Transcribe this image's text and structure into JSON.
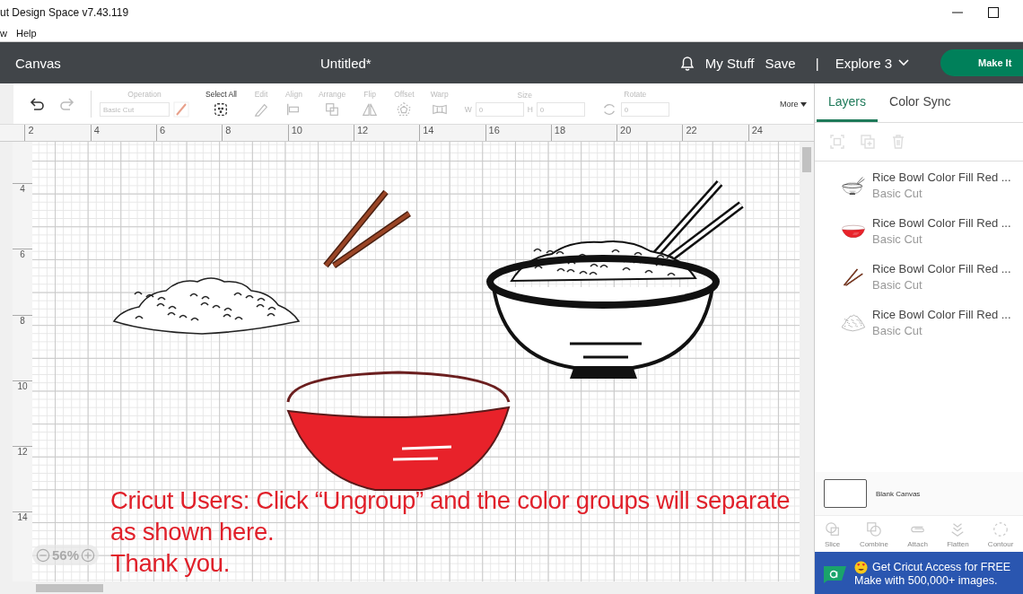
{
  "window": {
    "title": "ut Design Space  v7.43.119"
  },
  "menu": [
    "w",
    "Help"
  ],
  "header": {
    "section": "Canvas",
    "document": "Untitled*",
    "links": [
      "My Stuff",
      "Save"
    ],
    "separator": "|",
    "machine": "Explore 3",
    "make_button": "Make It"
  },
  "toolbar": {
    "history": [
      {
        "disabled": false
      },
      {
        "disabled": true
      }
    ],
    "items": [
      {
        "kind": "operation",
        "label": "Operation",
        "value": "Basic Cut",
        "disabled": true
      },
      {
        "kind": "tool",
        "label": "Select All",
        "disabled": false
      },
      {
        "kind": "tool",
        "label": "Edit",
        "disabled": true
      },
      {
        "kind": "tool",
        "label": "Align",
        "disabled": true
      },
      {
        "kind": "tool",
        "label": "Arrange",
        "disabled": true
      },
      {
        "kind": "tool",
        "label": "Flip",
        "disabled": true
      },
      {
        "kind": "tool",
        "label": "Offset",
        "disabled": true
      },
      {
        "kind": "tool",
        "label": "Warp",
        "disabled": true
      },
      {
        "kind": "size",
        "label": "Size",
        "fields": [
          {
            "label": "W",
            "value": "0"
          },
          {
            "label": "H",
            "value": "0"
          }
        ],
        "disabled": true
      },
      {
        "kind": "rotate",
        "label": "Rotate",
        "value": "0",
        "disabled": true
      },
      {
        "kind": "more",
        "label": "More"
      }
    ]
  },
  "top_ruler": [
    "2",
    "4",
    "6",
    "8",
    "10",
    "12",
    "14",
    "16",
    "18",
    "20",
    "22",
    "24"
  ],
  "left_ruler": [
    "4",
    "6",
    "8",
    "10",
    "12",
    "14"
  ],
  "canvas": {
    "annotation": [
      "Cricut Users: Click “Ungroup” and the color groups will separate",
      "as shown here.",
      "Thank you."
    ],
    "zoom": "56%"
  },
  "panel": {
    "tabs": [
      {
        "label": "Layers",
        "selected": true
      },
      {
        "label": "Color Sync",
        "selected": false
      }
    ],
    "layers": [
      {
        "kind": "bowl",
        "name": "Rice Bowl Color Fill Red ...",
        "operation": "Basic Cut"
      },
      {
        "kind": "red-bowl",
        "name": "Rice Bowl Color Fill Red ...",
        "operation": "Basic Cut"
      },
      {
        "kind": "chopsticks",
        "name": "Rice Bowl Color Fill Red ...",
        "operation": "Basic Cut"
      },
      {
        "kind": "rice",
        "name": "Rice Bowl Color Fill Red ...",
        "operation": "Basic Cut"
      }
    ],
    "blank_canvas": "Blank Canvas",
    "tools": [
      {
        "label": "Slice",
        "disabled": true
      },
      {
        "label": "Combine",
        "disabled": true
      },
      {
        "label": "Attach",
        "disabled": true
      },
      {
        "label": "Flatten",
        "disabled": true
      },
      {
        "label": "Contour",
        "disabled": true
      }
    ],
    "banner": {
      "lines": [
        "Get Cricut Access for FREE",
        "Make with 500,000+ images."
      ]
    }
  }
}
